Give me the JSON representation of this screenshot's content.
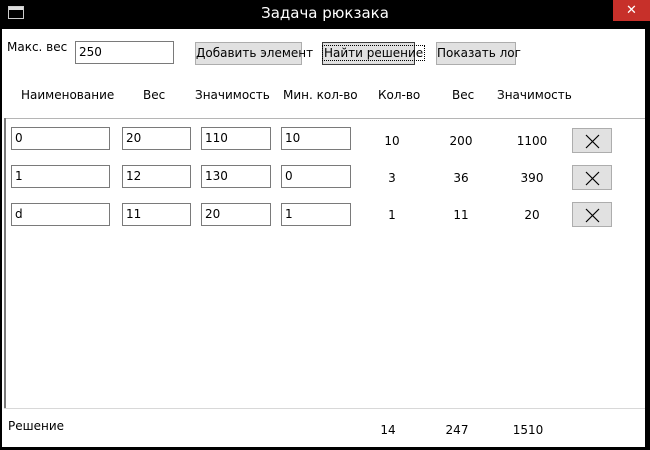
{
  "window": {
    "title": "Задача рюкзака",
    "close_glyph": "✕"
  },
  "toolbar": {
    "max_weight_label": "Макс. вес",
    "max_weight_value": "250",
    "add_item_label": "Добавить элемент",
    "find_solution_label": "Найти решение",
    "show_log_label": "Показать лог"
  },
  "columns": {
    "name": "Наименование",
    "weight": "Вес",
    "value": "Значимость",
    "min_count": "Мин. кол-во",
    "count": "Кол-во",
    "total_weight": "Вес",
    "total_value": "Значимость"
  },
  "rows": [
    {
      "name": "0",
      "weight": "20",
      "value": "110",
      "min_count": "10",
      "count": "10",
      "total_weight": "200",
      "total_value": "1100"
    },
    {
      "name": "1",
      "weight": "12",
      "value": "130",
      "min_count": "0",
      "count": "3",
      "total_weight": "36",
      "total_value": "390"
    },
    {
      "name": "d",
      "weight": "11",
      "value": "20",
      "min_count": "1",
      "count": "1",
      "total_weight": "11",
      "total_value": "20"
    }
  ],
  "solution": {
    "label": "Решение",
    "count": "14",
    "total_weight": "247",
    "total_value": "1510"
  },
  "icons": {
    "delete": "close-x-icon",
    "app": "window-icon"
  }
}
